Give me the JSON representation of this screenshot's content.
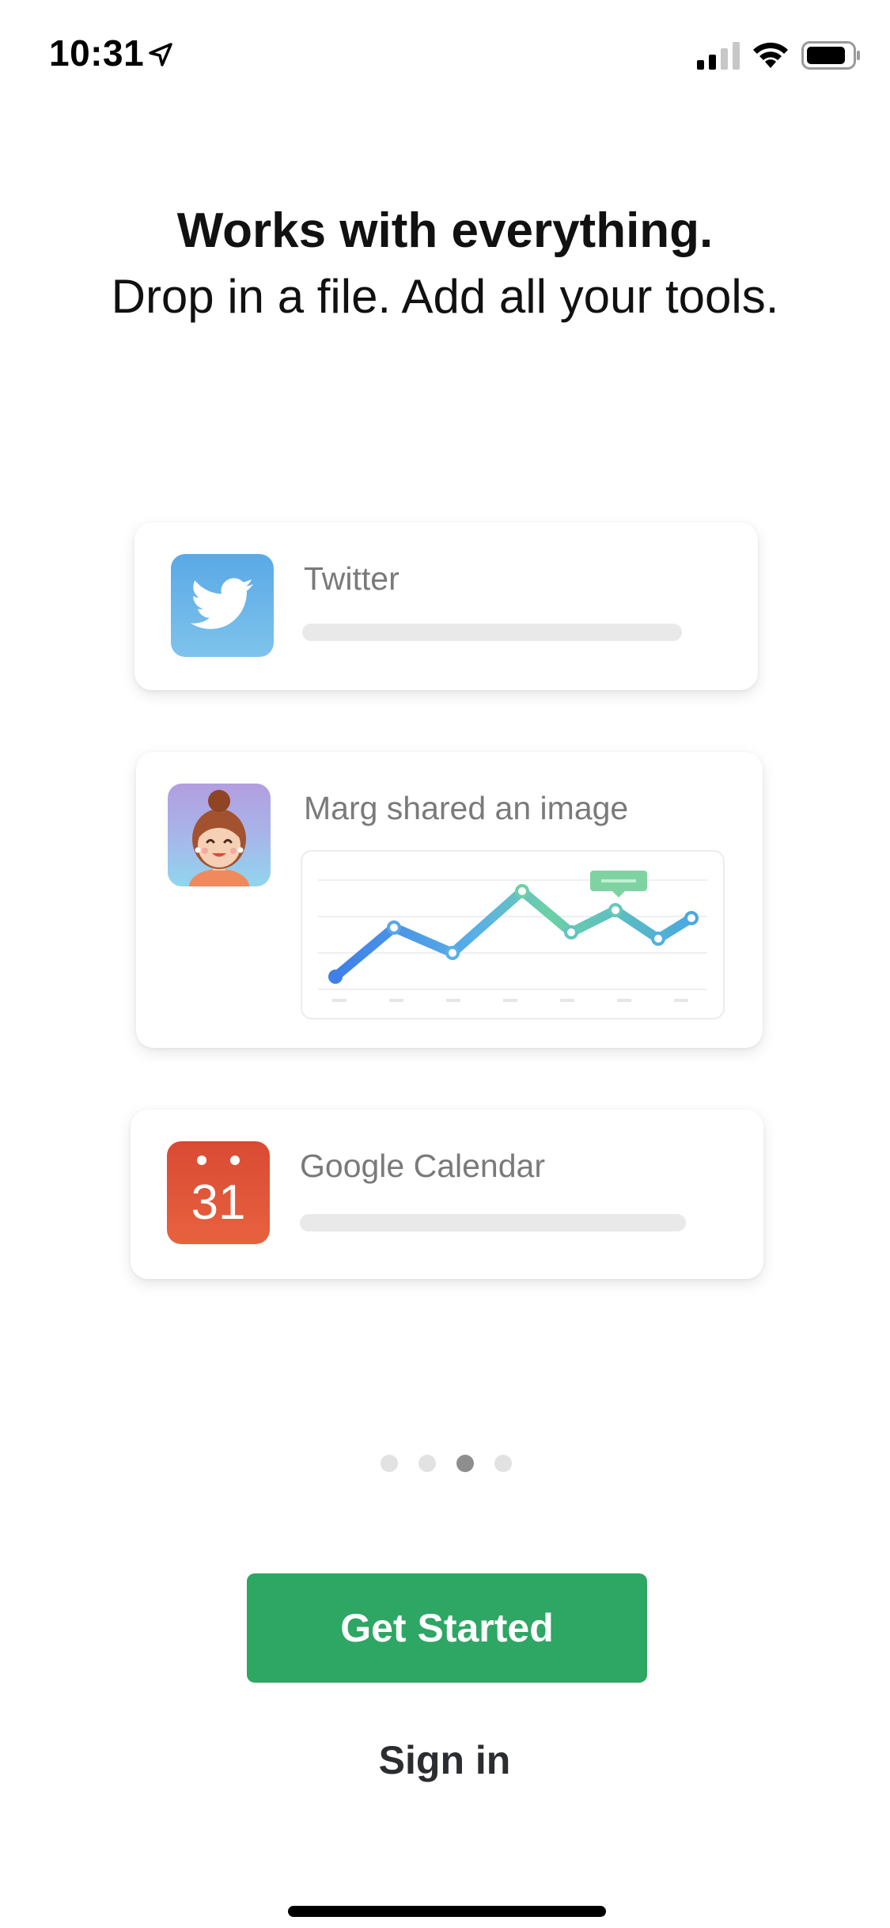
{
  "status_bar": {
    "time": "10:31",
    "icons": [
      "location-arrow-icon",
      "cellular-signal-icon",
      "wifi-icon",
      "battery-icon"
    ]
  },
  "headline": "Works with everything.",
  "subhead": "Drop in a file. Add all your tools.",
  "cards": [
    {
      "title": "Twitter",
      "icon": "twitter-bird-icon",
      "icon_color": "#55acee"
    },
    {
      "title": "Marg shared an image",
      "icon": "avatar-woman",
      "chart_icon": "line-chart-preview"
    },
    {
      "title": "Google Calendar",
      "icon": "calendar-icon",
      "icon_number": "31",
      "icon_color": "#e0523a"
    }
  ],
  "pager": {
    "count": 4,
    "active_index": 2
  },
  "buttons": {
    "get_started": "Get Started",
    "sign_in": "Sign in"
  },
  "colors": {
    "primary_green": "#2ea664",
    "card_text": "#7a7a7a"
  }
}
